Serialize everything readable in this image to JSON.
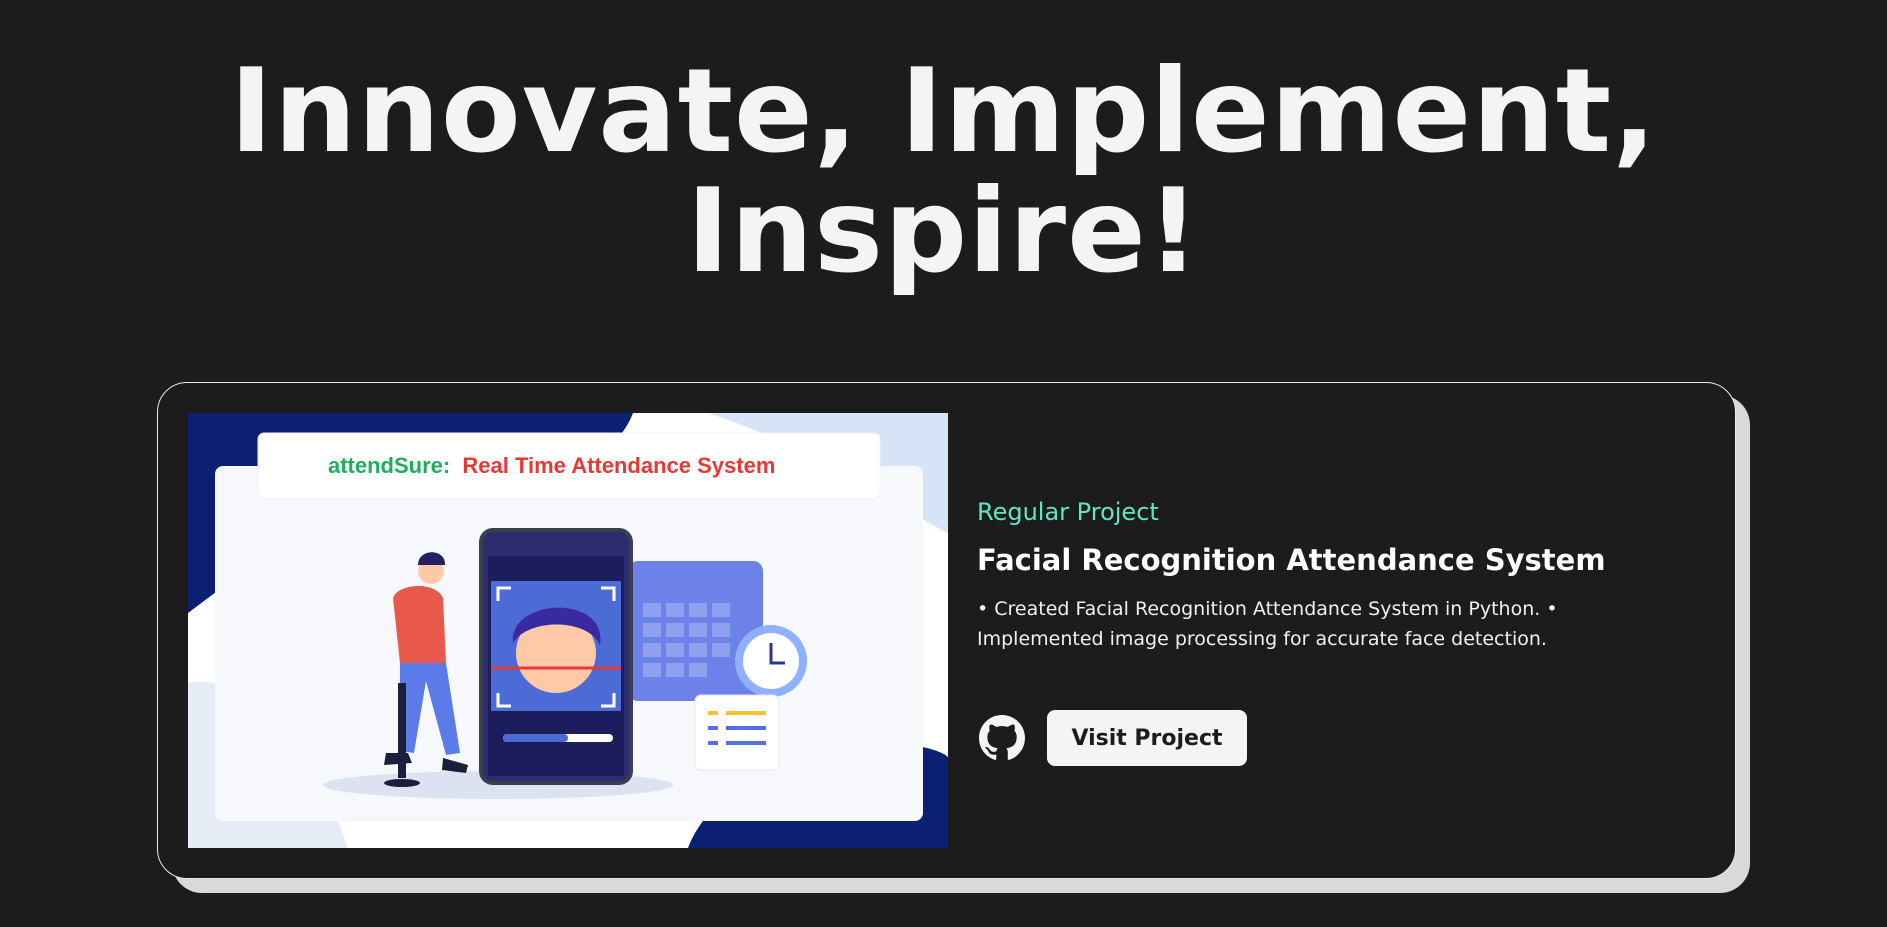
{
  "hero": {
    "title_line1": "Innovate, Implement,",
    "title_line2": "Inspire!"
  },
  "project": {
    "thumbnail": {
      "brand": "attendSure:",
      "headline": "Real Time Attendance System"
    },
    "category": "Regular Project",
    "title": "Facial Recognition Attendance System",
    "description": "• Created Facial Recognition Attendance System in Python. • Implemented image processing for accurate face detection.",
    "github_icon": "github-icon",
    "visit_label": "Visit Project"
  },
  "colors": {
    "background": "#1c1c1c",
    "category_accent": "#5ee7c3",
    "brand_green": "#1fae5b",
    "headline_red": "#e53935",
    "card_border": "#e8e8e8"
  }
}
